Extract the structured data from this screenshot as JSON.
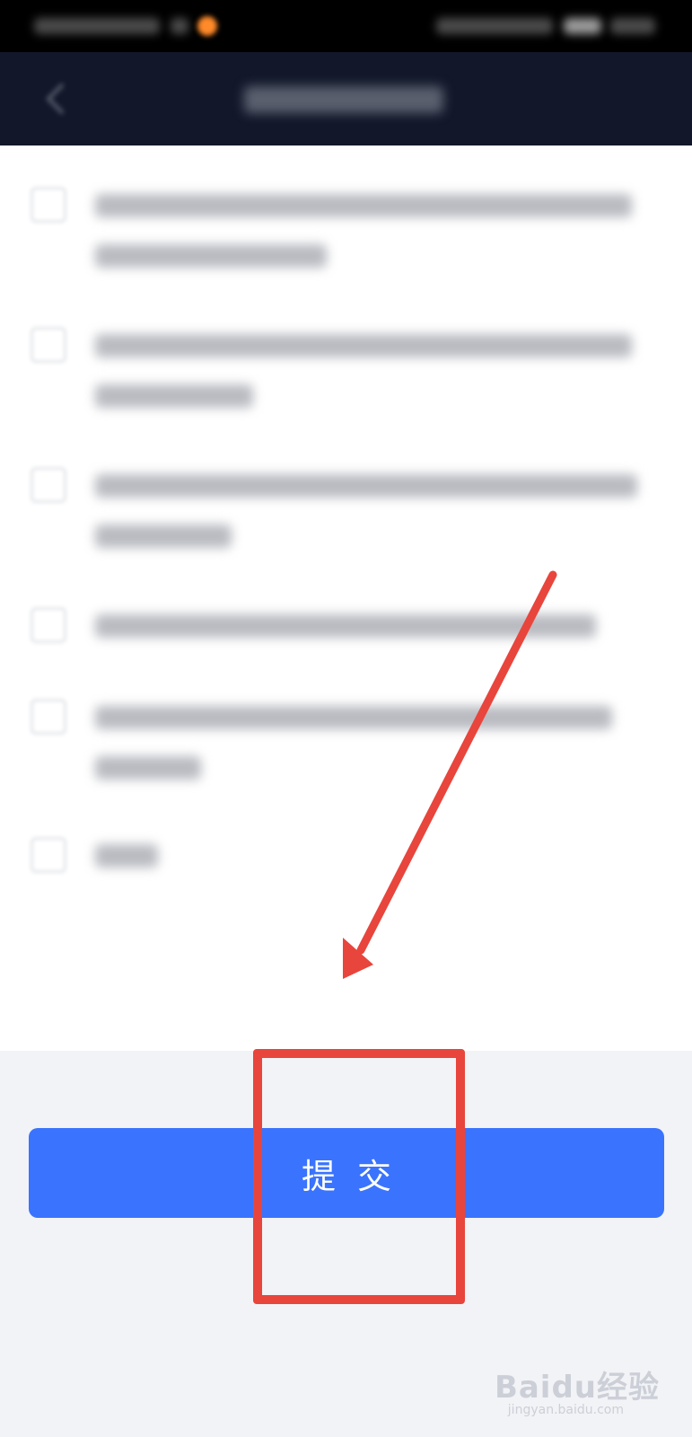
{
  "submit": {
    "label": "提交",
    "color": "#3a73fd"
  },
  "annotation": {
    "highlight_color": "#e8453c"
  },
  "watermark": {
    "brand": "Baidu经验",
    "url": "jingyan.baidu.com"
  },
  "icons": {
    "back": "back-arrow-icon",
    "checkbox": "checkbox-icon"
  }
}
